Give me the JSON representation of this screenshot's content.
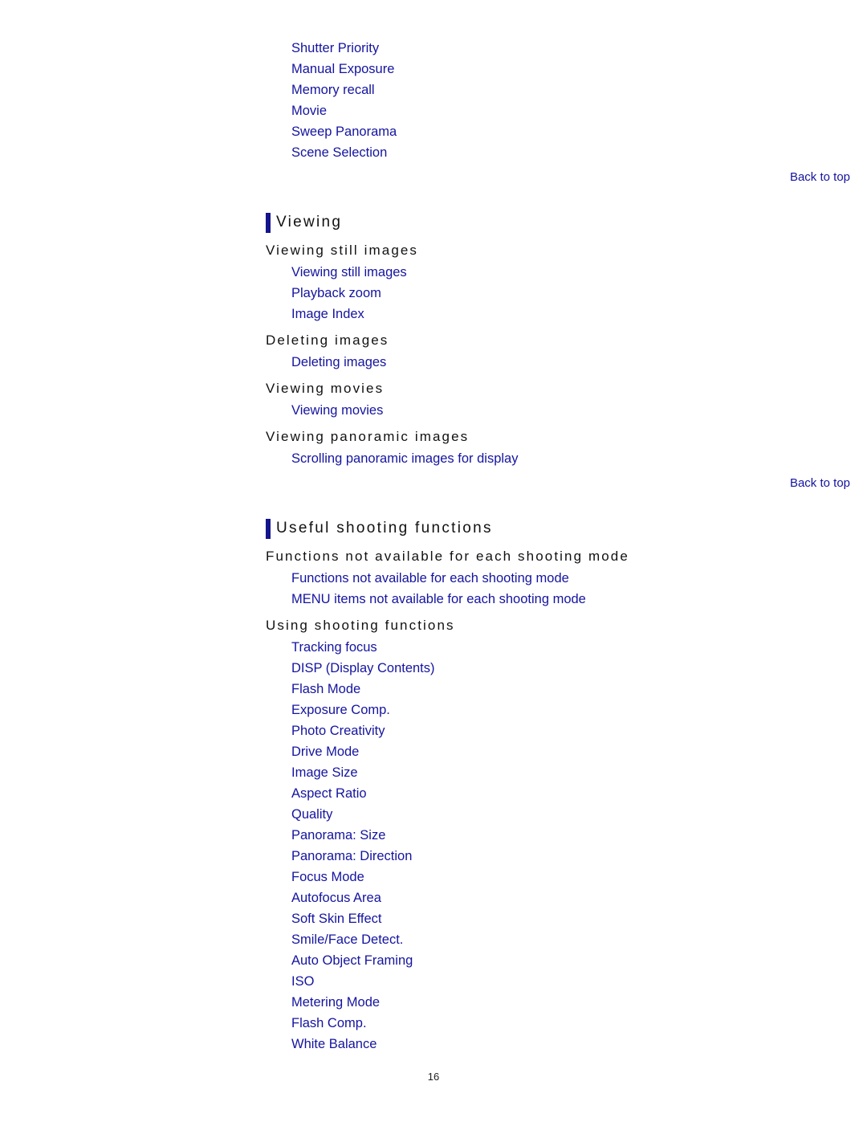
{
  "top_links": [
    "Shutter Priority",
    "Manual Exposure",
    "Memory recall",
    "Movie",
    "Sweep Panorama",
    "Scene Selection"
  ],
  "back_to_top": "Back to top",
  "sections": [
    {
      "title": "Viewing",
      "groups": [
        {
          "heading": "Viewing still images",
          "links": [
            "Viewing still images",
            "Playback zoom",
            "Image Index"
          ]
        },
        {
          "heading": "Deleting images",
          "links": [
            "Deleting images"
          ]
        },
        {
          "heading": "Viewing movies",
          "links": [
            "Viewing movies"
          ]
        },
        {
          "heading": "Viewing panoramic images",
          "links": [
            "Scrolling panoramic images for display"
          ]
        }
      ]
    },
    {
      "title": "Useful shooting functions",
      "groups": [
        {
          "heading": "Functions not available for each shooting mode",
          "links": [
            "Functions not available for each shooting mode",
            "MENU items not available for each shooting mode"
          ]
        },
        {
          "heading": "Using shooting functions",
          "links": [
            "Tracking focus",
            "DISP (Display Contents)",
            "Flash Mode",
            "Exposure Comp.",
            "Photo Creativity",
            "Drive Mode",
            "Image Size",
            "Aspect Ratio",
            "Quality",
            "Panorama: Size",
            "Panorama: Direction",
            "Focus Mode",
            "Autofocus Area",
            "Soft Skin Effect",
            "Smile/Face Detect.",
            "Auto Object Framing",
            "ISO",
            "Metering Mode",
            "Flash Comp.",
            "White Balance"
          ]
        }
      ]
    }
  ],
  "page_number": "16",
  "colors": {
    "link": "#1414a0",
    "section_bar": "#14148c",
    "text": "#111111"
  }
}
